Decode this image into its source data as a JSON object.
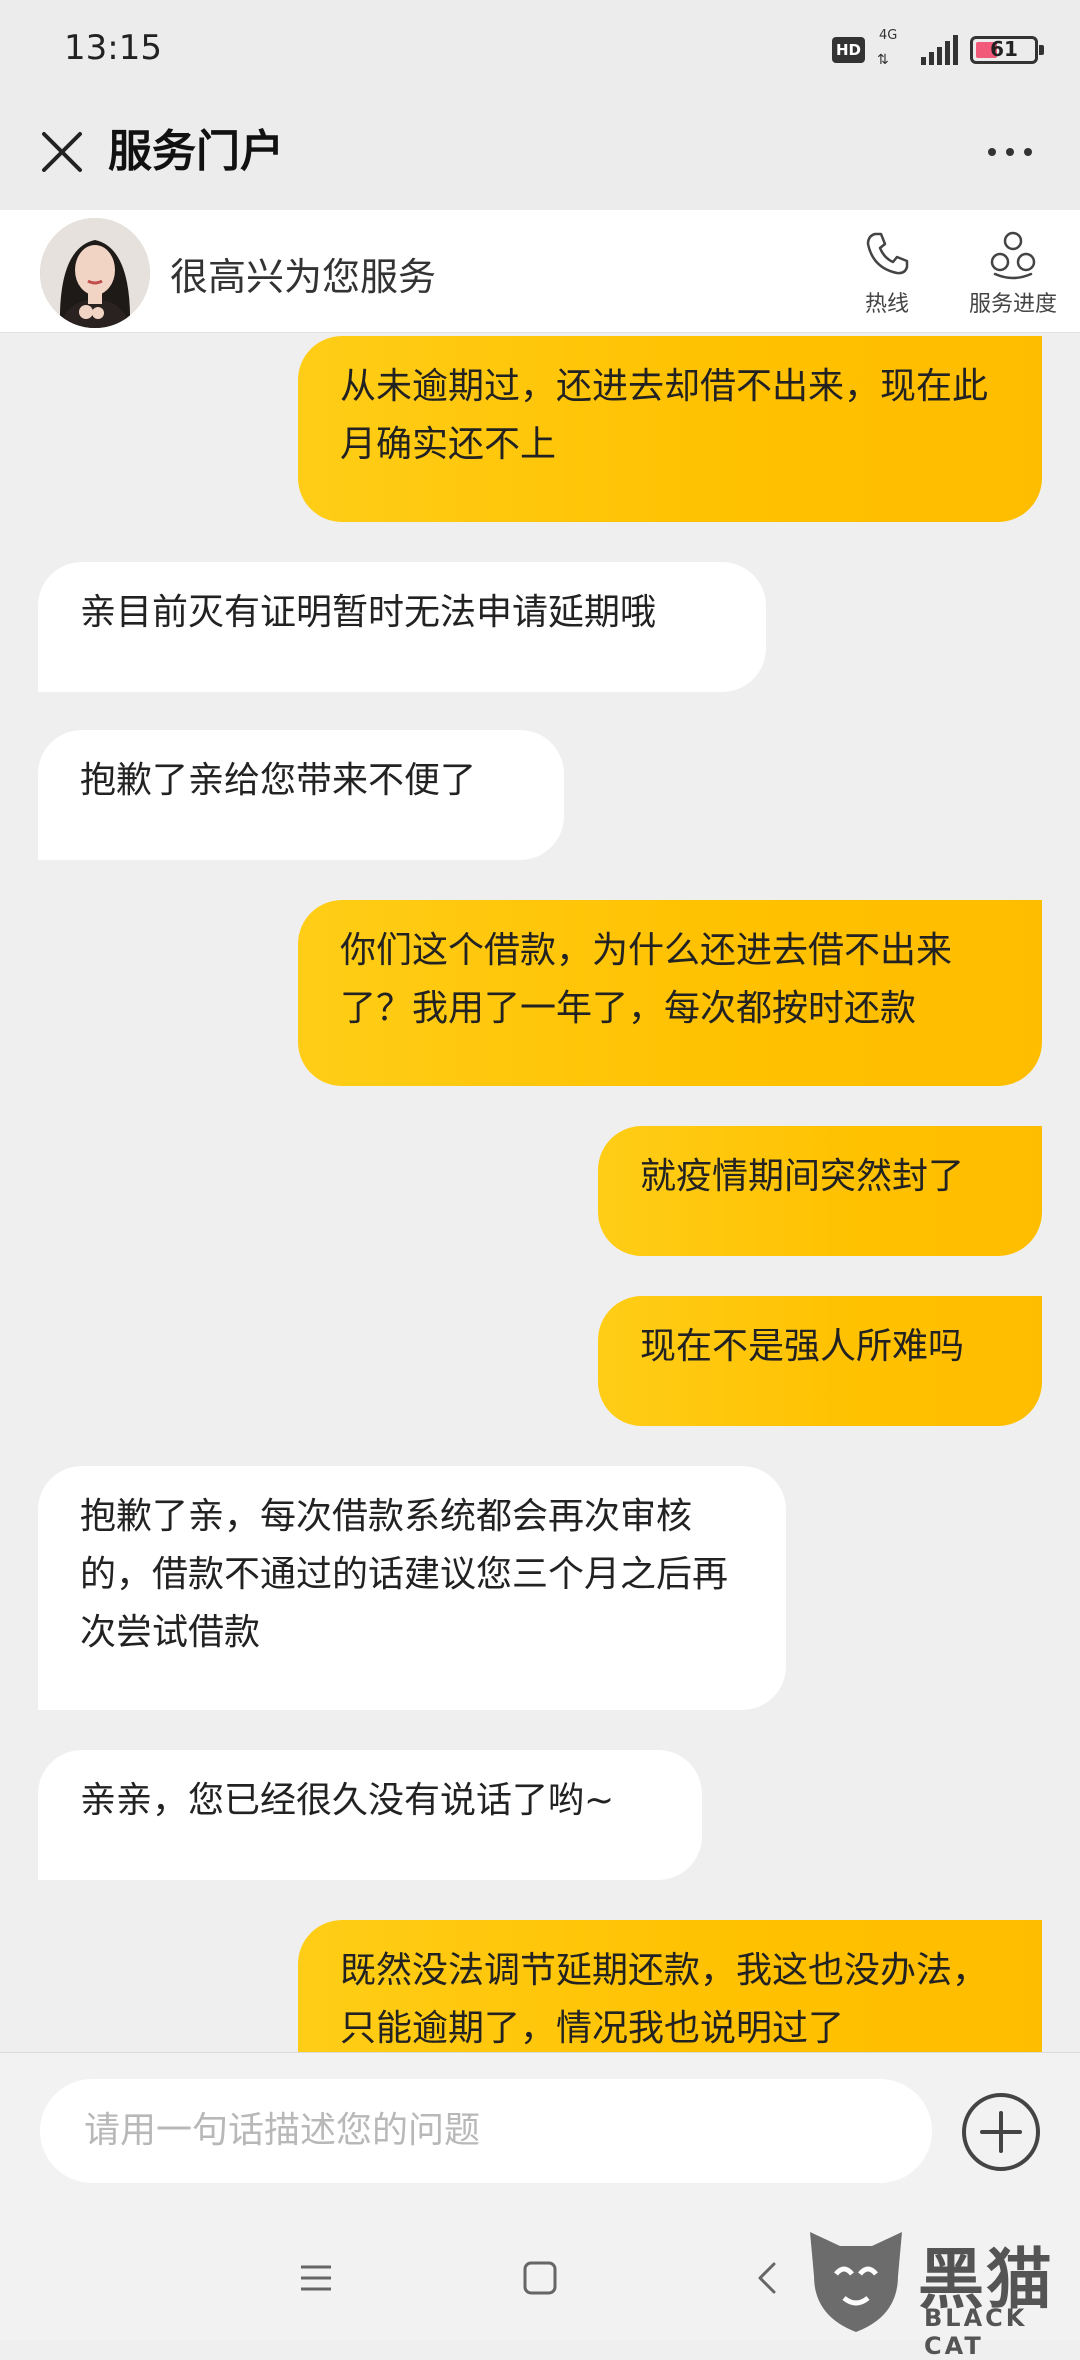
{
  "status_bar": {
    "time": "13:15",
    "hd_badge": "HD",
    "network_type": "4G",
    "battery_level": "61"
  },
  "title_bar": {
    "title": "服务门户"
  },
  "agent_bar": {
    "greeting": "很高兴为您服务",
    "hotline_label": "热线",
    "progress_label": "服务进度"
  },
  "messages": [
    {
      "side": "out",
      "text": "从未逾期过，还进去却借不出来，现在此月确实还不上"
    },
    {
      "side": "in",
      "text": "亲目前灭有证明暂时无法申请延期哦"
    },
    {
      "side": "in",
      "text": "抱歉了亲给您带来不便了"
    },
    {
      "side": "out",
      "text": "你们这个借款，为什么还进去借不出来了？我用了一年了，每次都按时还款"
    },
    {
      "side": "out",
      "text": "就疫情期间突然封了"
    },
    {
      "side": "out",
      "text": "现在不是强人所难吗"
    },
    {
      "side": "in",
      "text": "抱歉了亲，每次借款系统都会再次审核的，借款不通过的话建议您三个月之后再次尝试借款"
    },
    {
      "side": "in",
      "text": "亲亲，您已经很久没有说话了哟~"
    },
    {
      "side": "out",
      "text": "既然没法调节延期还款，我这也没办法，只能逾期了，情况我也说明过了"
    }
  ],
  "input": {
    "placeholder": "请用一句话描述您的问题"
  },
  "watermark": {
    "text_cn": "黑猫",
    "text_en": "BLACK CAT"
  },
  "colors": {
    "outgoing_bubble": "#ffc100",
    "incoming_bubble": "#ffffff",
    "background": "#efefef"
  }
}
